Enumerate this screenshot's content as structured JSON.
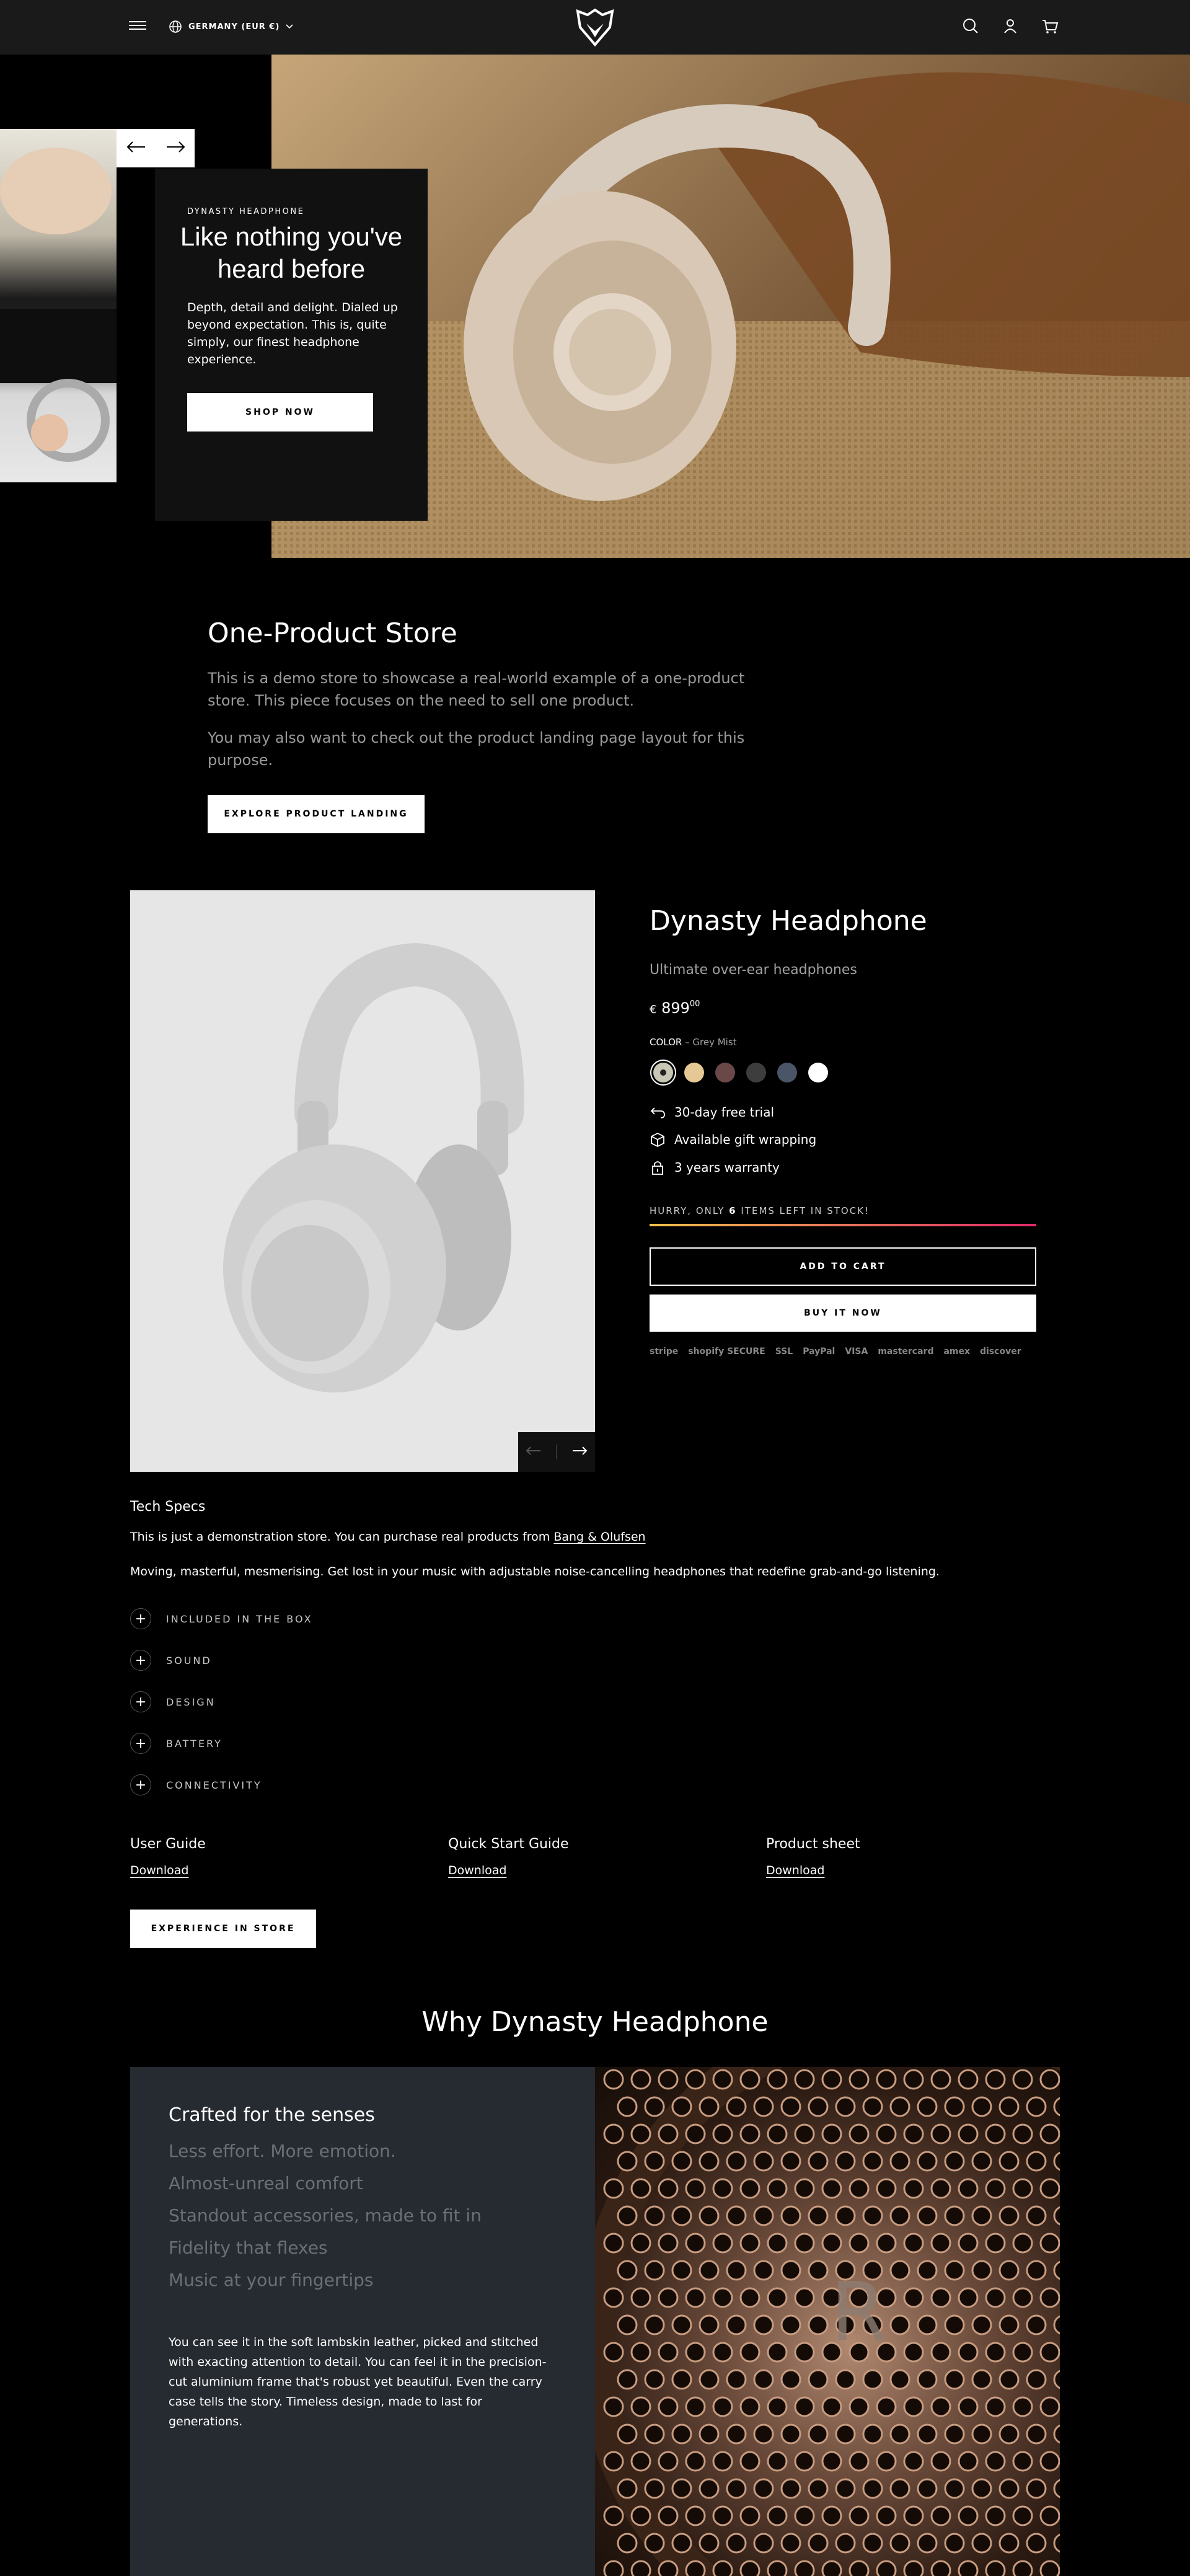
{
  "header": {
    "locale": "GERMANY (EUR €)"
  },
  "hero": {
    "eyebrow": "DYNASTY HEADPHONE",
    "title": "Like nothing you've heard before",
    "text": "Depth, detail and delight. Dialed up beyond expectation. This is, quite simply, our finest headphone experience.",
    "button": "SHOP NOW"
  },
  "intro": {
    "title": "One-Product Store",
    "paragraph1": "This is a demo store to showcase a real-world example of a one-product store. This piece focuses on the need to sell one product.",
    "paragraph2": "You may also want to check out the product landing page layout for this purpose.",
    "button": "EXPLORE PRODUCT LANDING"
  },
  "product": {
    "title": "Dynasty Headphone",
    "subtitle": "Ultimate over-ear headphones",
    "currency": "€",
    "price_main": "899",
    "price_cents": "00",
    "color_label": "COLOR",
    "color_value": "– Grey Mist",
    "swatches": [
      "#c8c6b4",
      "#e6c894",
      "#6b4848",
      "#3d3d3d",
      "#4a5668",
      "#ffffff"
    ],
    "features": [
      "30-day free trial",
      "Available gift wrapping",
      "3 years warranty"
    ],
    "stock_prefix": "HURRY, ONLY ",
    "stock_count": "6",
    "stock_suffix": " ITEMS LEFT IN STOCK!",
    "add_to_cart": "ADD TO CART",
    "buy_now": "BUY IT NOW",
    "payment_badges": [
      "stripe",
      "shopify SECURE",
      "SSL",
      "PayPal",
      "VISA",
      "mastercard",
      "amex",
      "discover"
    ]
  },
  "specs": {
    "heading": "Tech Specs",
    "line1": "This is just a demonstration store. You can purchase real products from ",
    "link": "Bang & Olufsen",
    "line2": "Moving, masterful, mesmerising. Get lost in your music with adjustable noise-cancelling headphones that redefine grab-and-go listening.",
    "accordion": [
      "INCLUDED IN THE BOX",
      "SOUND",
      "DESIGN",
      "BATTERY",
      "CONNECTIVITY"
    ]
  },
  "downloads": [
    {
      "title": "User Guide",
      "link": "Download"
    },
    {
      "title": "Quick Start Guide",
      "link": "Download"
    },
    {
      "title": "Product sheet",
      "link": "Download"
    }
  ],
  "experience_button": "EXPERIENCE IN STORE",
  "why": {
    "title": "Why Dynasty Headphone",
    "active": "Crafted for the senses",
    "items": [
      "Less effort. More emotion.",
      "Almost-unreal comfort",
      "Standout accessories, made to fit in",
      "Fidelity that flexes",
      "Music at your fingertips"
    ],
    "body": "You can see it in the soft lambskin leather, picked and stitched with exacting attention to detail. You can feel it in the precision-cut aluminium frame that's robust yet beautiful. Even the carry case tells the story. Timeless design, made to last for generations."
  }
}
